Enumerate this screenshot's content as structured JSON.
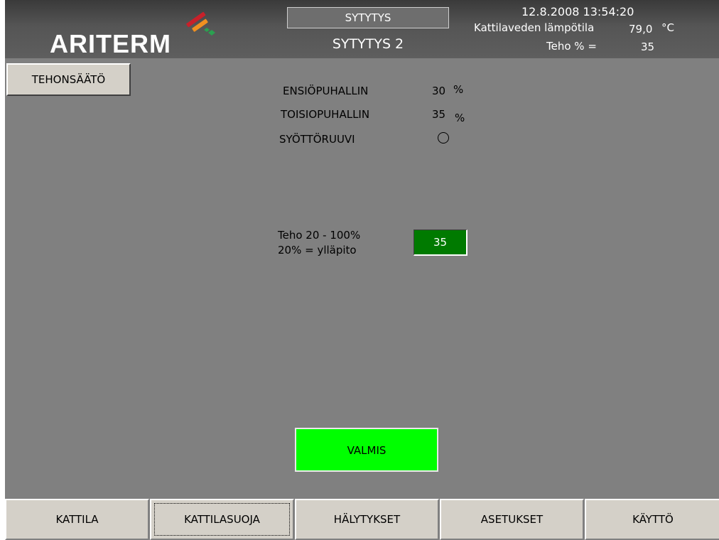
{
  "header": {
    "logo": "ARITERM",
    "mode_title": "SYTYTYS",
    "mode_subtitle": "SYTYTYS 2",
    "datetime": "12.8.2008 13:54:20",
    "water_temp_label": "Kattilaveden lämpötila",
    "water_temp_value": "79,0",
    "water_temp_unit": "°C",
    "power_label": "Teho % =",
    "power_value": "35"
  },
  "left_button": {
    "label": "TEHONSÄÄTÖ"
  },
  "status": {
    "primary_fan_label": "ENSIÖPUHALLIN",
    "primary_fan_value": "30",
    "primary_fan_unit": "%",
    "secondary_fan_label": "TOISIOPUHALLIN",
    "secondary_fan_value": "35",
    "secondary_fan_unit": "%",
    "feed_screw_label": "SYÖTTÖRUUVI"
  },
  "power_control": {
    "range_label": "Teho 20 - 100%",
    "maintenance_label": "20% = ylläpito",
    "value": "35"
  },
  "ready_label": "VALMIS",
  "nav": [
    "KATTILA",
    "KATTILASUOJA",
    "HÄLYTYKSET",
    "ASETUKSET",
    "KÄYTTÖ"
  ],
  "nav_active_index": 1,
  "colors": {
    "power_field": "#007a00",
    "ready": "#00ff00",
    "logo_red": "#c8202a",
    "logo_orange": "#f09020",
    "logo_green": "#2aa050"
  }
}
